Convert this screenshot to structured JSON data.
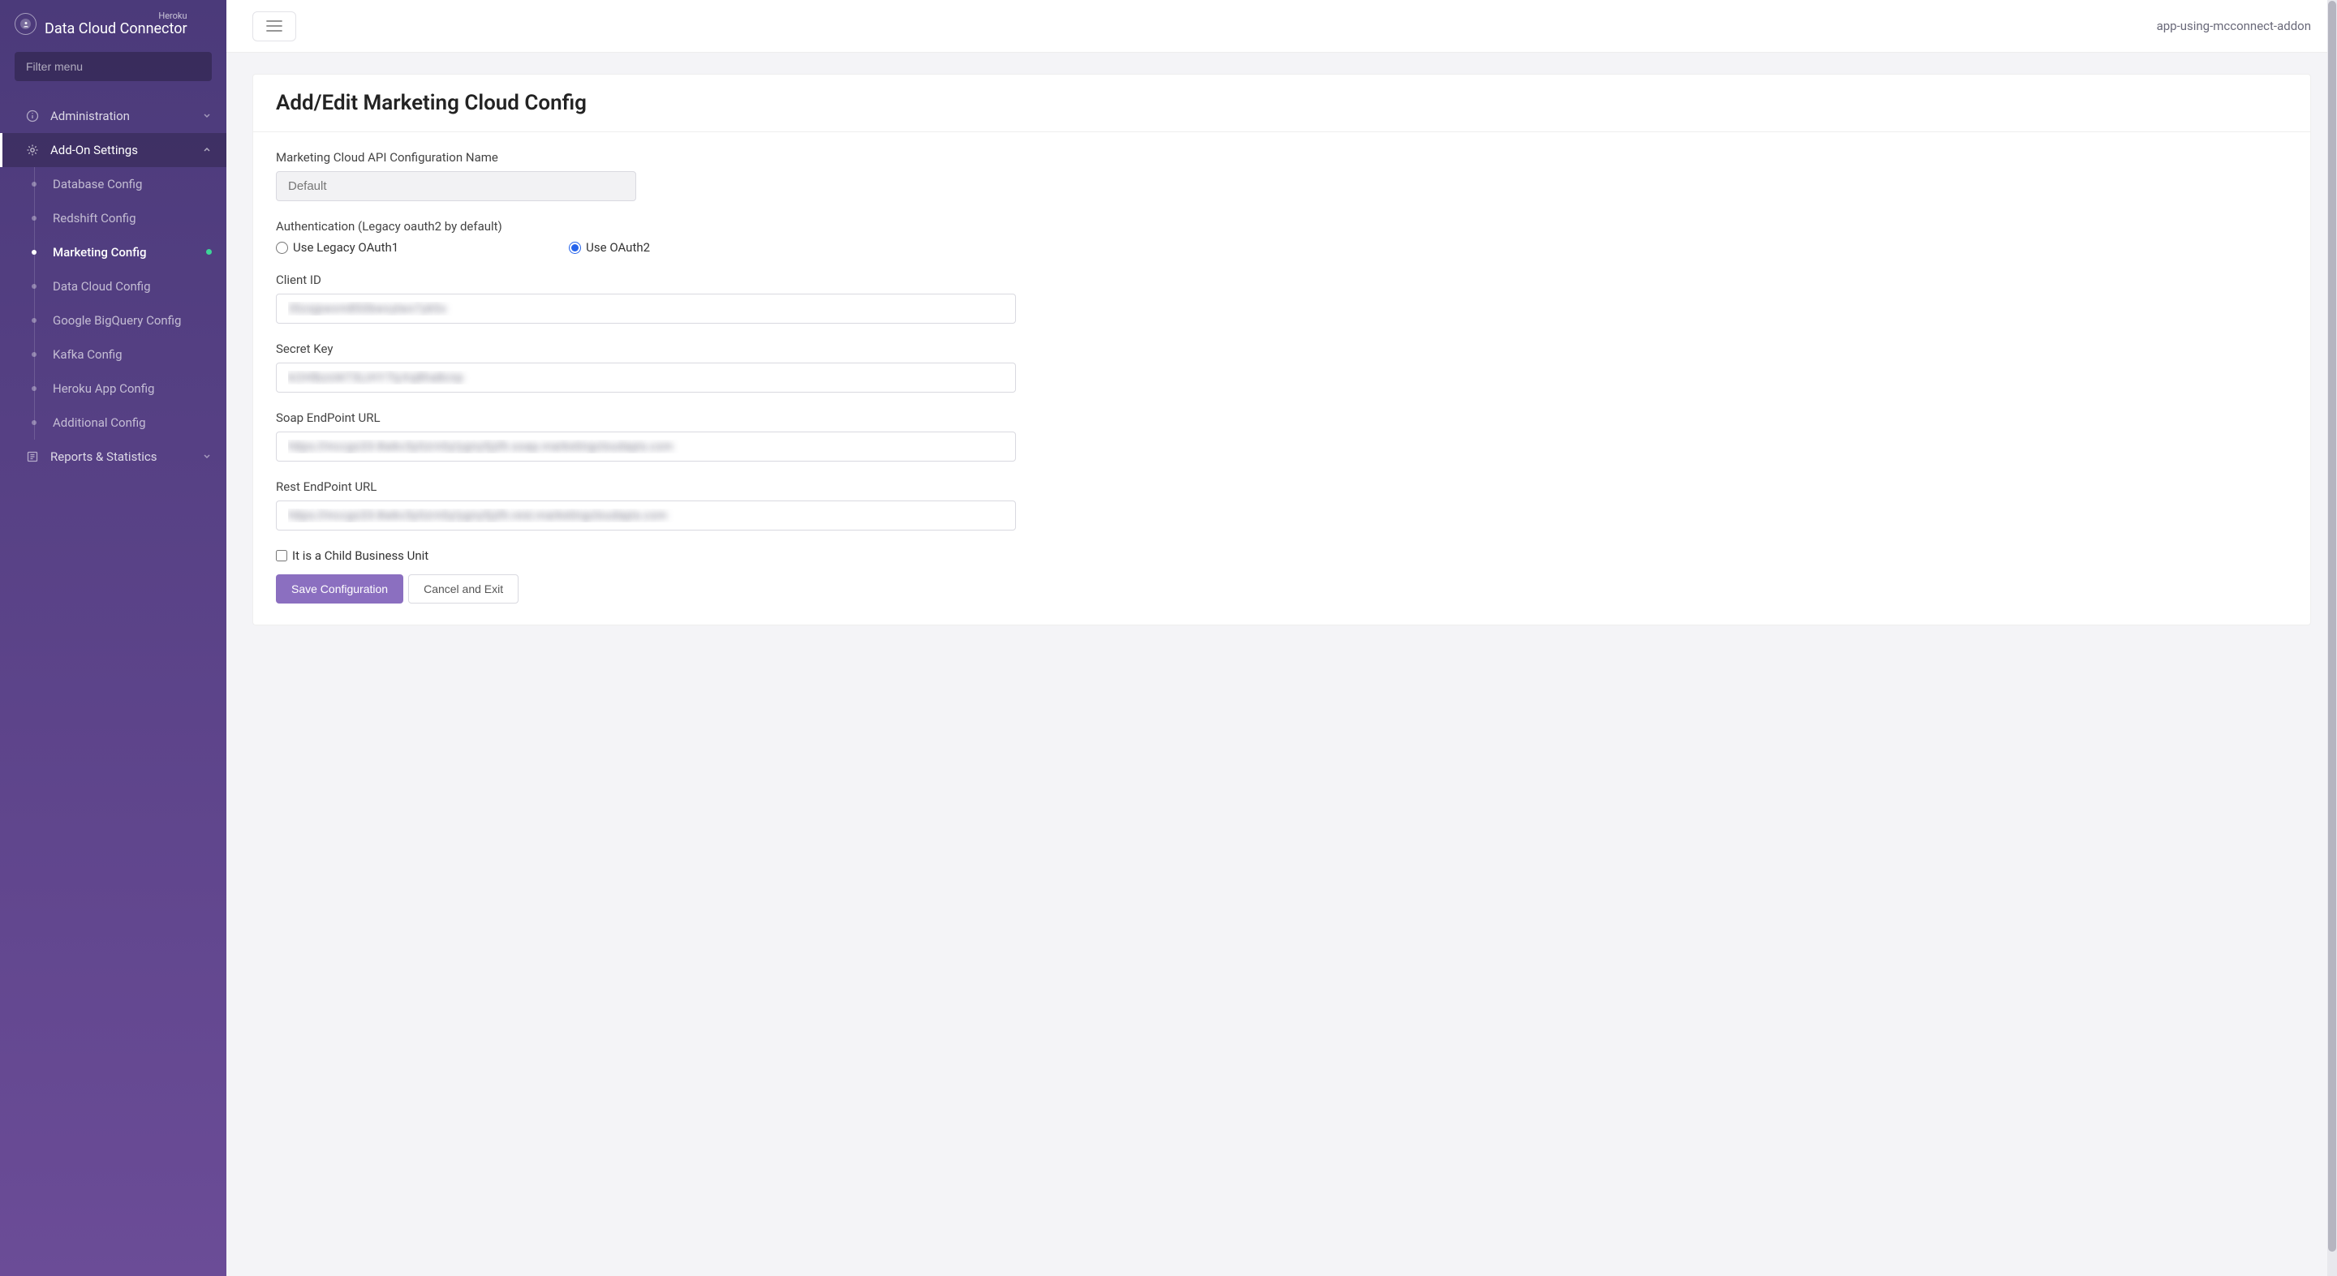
{
  "brand": {
    "subtitle": "Heroku",
    "title": "Data Cloud Connector"
  },
  "sidebar": {
    "filter_placeholder": "Filter menu",
    "sections": [
      {
        "label": "Administration"
      },
      {
        "label": "Add-On Settings"
      },
      {
        "label": "Reports & Statistics"
      }
    ],
    "addon_items": [
      {
        "label": "Database Config"
      },
      {
        "label": "Redshift Config"
      },
      {
        "label": "Marketing Config"
      },
      {
        "label": "Data Cloud Config"
      },
      {
        "label": "Google BigQuery Config"
      },
      {
        "label": "Kafka Config"
      },
      {
        "label": "Heroku App Config"
      },
      {
        "label": "Additional Config"
      }
    ]
  },
  "topbar": {
    "app_name": "app-using-mcconnect-addon"
  },
  "page": {
    "title": "Add/Edit Marketing Cloud Config",
    "labels": {
      "config_name": "Marketing Cloud API Configuration Name",
      "auth": "Authentication (Legacy oauth2 by default)",
      "oauth1": "Use Legacy OAuth1",
      "oauth2": "Use OAuth2",
      "client_id": "Client ID",
      "secret_key": "Secret Key",
      "soap_url": "Soap EndPoint URL",
      "rest_url": "Rest EndPoint URL",
      "child_bu": "It is a Child Business Unit"
    },
    "values": {
      "config_name": "Default",
      "client_id": "35zsjpwvm850bwvytwx7yk5x",
      "secret_key": "kOHlbzsW73LiHY7tyXq8ha8cnp",
      "soap_url": "https://mccgs33-8wkv3y0zrn0y/ygny5jzlh.soap.marketingcloudapis.com",
      "rest_url": "https://mccgs33-8wkv3y0zrn0y/ygny5jzlh.rest.marketingcloudapis.com"
    },
    "buttons": {
      "save": "Save Configuration",
      "cancel": "Cancel and Exit"
    }
  }
}
